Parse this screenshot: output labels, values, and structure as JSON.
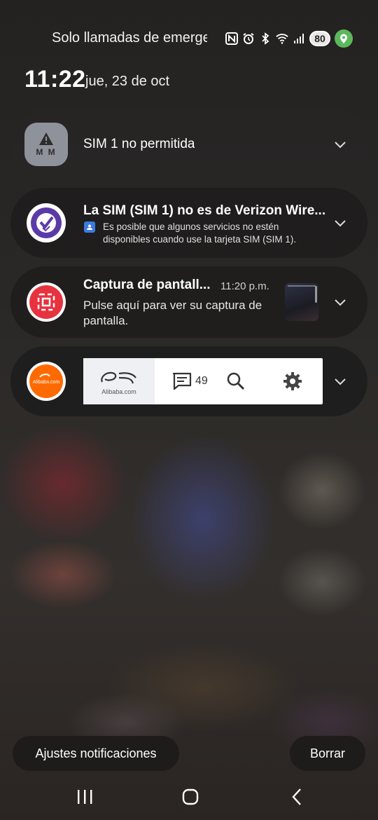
{
  "status_bar": {
    "carrier_text": "Solo llamadas de emerge",
    "battery_level": "80",
    "icons": [
      "nfc-icon",
      "alarm-icon",
      "bluetooth-icon",
      "wifi-icon",
      "signal-icon",
      "battery-icon",
      "location-icon"
    ]
  },
  "header": {
    "time": "11:22",
    "date": "jue, 23 de oct"
  },
  "notifications": [
    {
      "icon": "mm-warning-icon",
      "icon_label": "M M",
      "title": "SIM 1 no permitida"
    },
    {
      "icon": "verizon-check-icon",
      "title": "La SIM (SIM 1) no es de Verizon Wire...",
      "body": "Es posible que algunos servicios no estén disponibles cuando use la tarjeta SIM (SIM 1).",
      "body_icon": "contact-card-icon"
    },
    {
      "icon": "screenshot-icon",
      "title": "Captura de pantall...",
      "time": "11:20 p.m.",
      "body": "Pulse aquí para ver su captura de pantalla."
    },
    {
      "icon": "alibaba-icon",
      "icon_label": "Alibaba.com",
      "logo_text": "Alibaba.com",
      "message_count": "49",
      "toolbar_icons": [
        "message-icon",
        "search-icon",
        "settings-icon"
      ]
    }
  ],
  "footer": {
    "settings_label": "Ajustes notificaciones",
    "clear_label": "Borrar"
  },
  "navigation": {
    "buttons": [
      "recent-apps-icon",
      "home-icon",
      "back-icon"
    ]
  },
  "colors": {
    "card_bg": "#1e1d1c",
    "screenshot_red": "#e8323f",
    "alibaba_orange": "#ff6a00",
    "verizon_purple": "#5b3aa8",
    "location_green": "#5cb85c"
  }
}
